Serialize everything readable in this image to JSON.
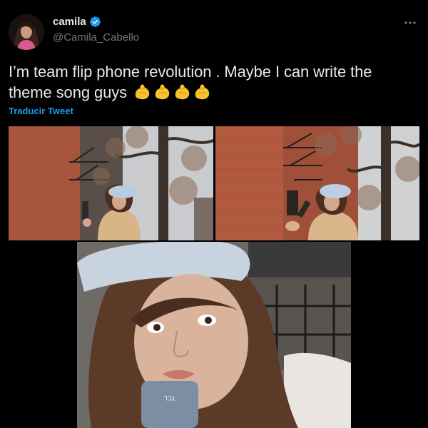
{
  "author": {
    "display_name": "camila",
    "handle": "@Camila_Cabello",
    "verified": true,
    "avatar_icon": "profile-photo"
  },
  "tweet": {
    "text": "I’m team flip phone revolution . Maybe I can write the theme song guys",
    "emojis": [
      "flexed-biceps",
      "flexed-biceps",
      "flexed-biceps",
      "flexed-biceps"
    ],
    "translate_label": "Traducir Tweet"
  },
  "media": {
    "photos": [
      {
        "alt_icon": "photo-woman-flip-phone-brick-building"
      },
      {
        "alt_icon": "photo-woman-flip-phone-brick-building-2"
      },
      {
        "alt_icon": "photo-selfie-with-flip-phone"
      }
    ],
    "phone_brand": "TCL"
  },
  "colors": {
    "background": "#000000",
    "text": "#e7e9ea",
    "secondary_text": "#71767b",
    "link": "#1d9bf0",
    "verified": "#1d9bf0"
  }
}
